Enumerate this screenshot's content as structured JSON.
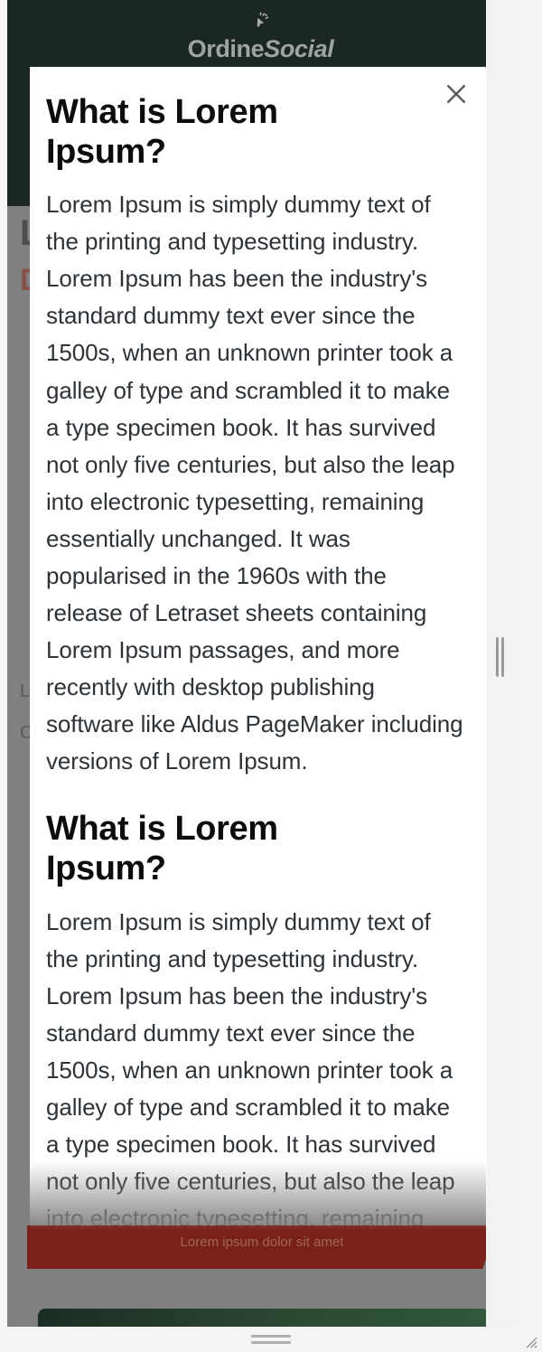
{
  "brand": {
    "name_bold": "Ordine",
    "name_italic": "Social",
    "icon": "cursor-click-icon"
  },
  "background": {
    "title": "Lorem Ipsum",
    "subtitle": "Dolor Sit Amet",
    "paragraph": "Lorem ipsum dolor sit amet consectetur",
    "paragraph2": "Consectetur adipiscing elit sed do",
    "star_icon": "star-icon",
    "banner_text": "Lorem ipsum dolor sit amet"
  },
  "modal": {
    "close_label": "×",
    "close_icon": "close-icon",
    "sections": [
      {
        "heading": "What is Lorem Ipsum?",
        "body": "Lorem Ipsum is simply dummy text of the printing and typesetting industry. Lorem Ipsum has been the industry's standard dummy text ever since the 1500s, when an unknown printer took a galley of type and scrambled it to make a type specimen book. It has survived not only five centuries, but also the leap into electronic typesetting, remaining essentially unchanged. It was popularised in the 1960s with the release of Letraset sheets containing Lorem Ipsum passages, and more recently with desktop publishing software like Aldus PageMaker including versions of Lorem Ipsum."
      },
      {
        "heading": "What is Lorem Ipsum?",
        "body": "Lorem Ipsum is simply dummy text of the printing and typesetting industry. Lorem Ipsum has been the industry's standard dummy text ever since the 1500s, when an unknown printer took a galley of type and scrambled it to make a type specimen book. It has survived not only five centuries, but also the leap into electronic typesetting, remaining essentially unchanged."
      }
    ]
  },
  "chrome": {
    "scrollbar_icon": "scroll-grip-icon",
    "drag_handle_icon": "drag-handle-icon",
    "resize_icon": "resize-corner-icon"
  },
  "colors": {
    "header_bg": "#1b2821",
    "overlay": "#808080",
    "modal_bg": "#ffffff",
    "banner_red": "#7a211c",
    "bar_green": "#2c4a34",
    "star_yellow": "#b89b2a"
  }
}
